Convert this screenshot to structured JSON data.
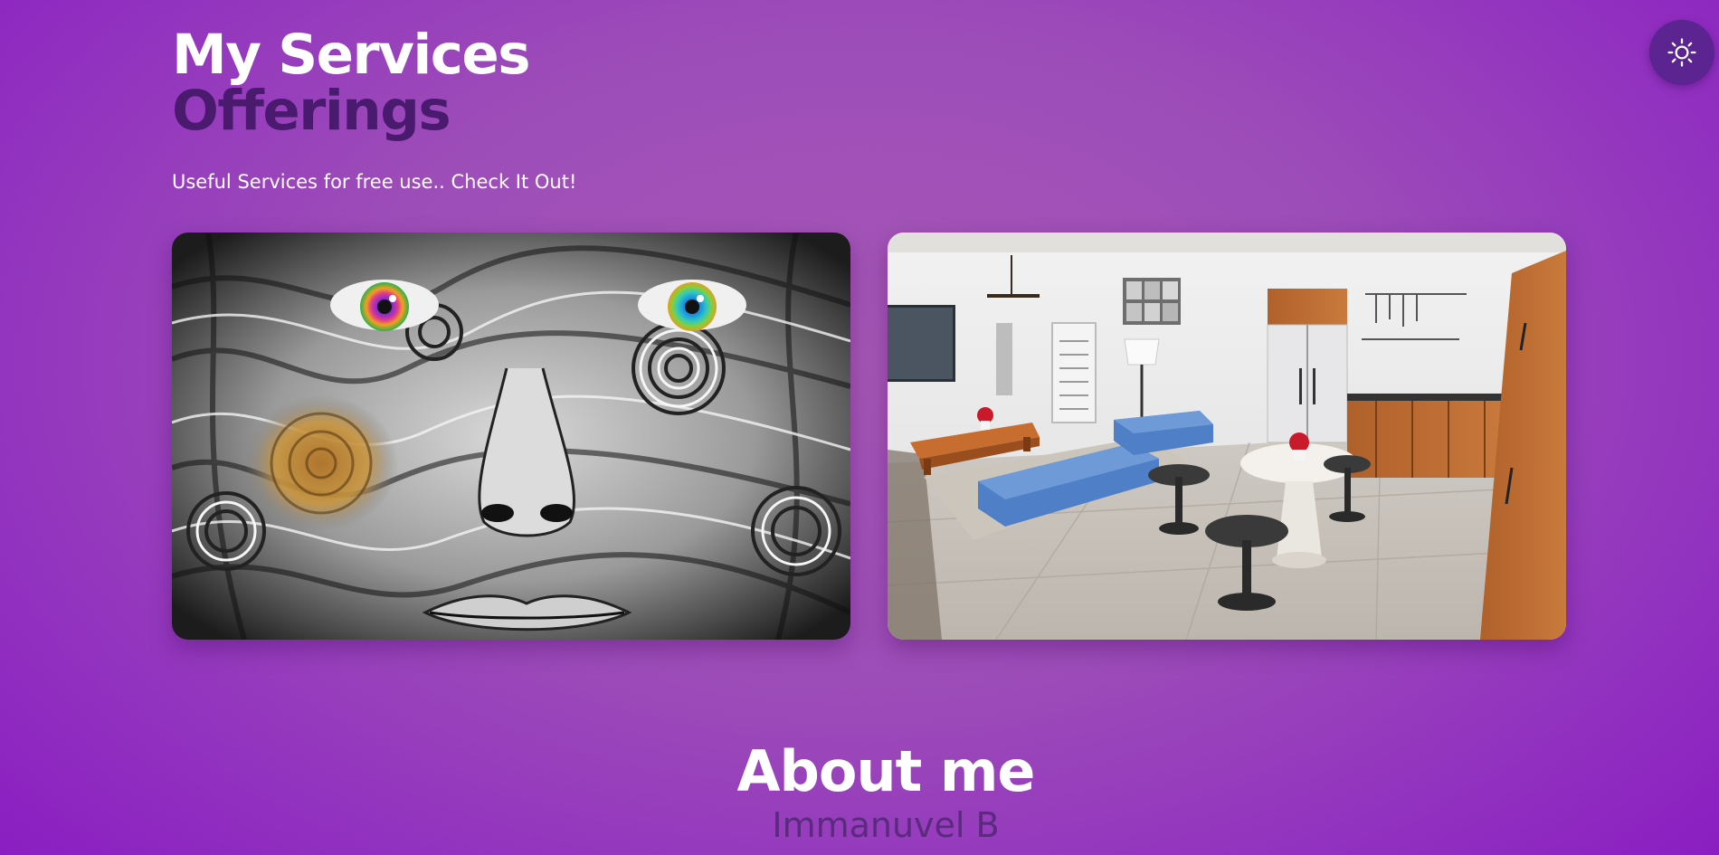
{
  "theme_toggle": {
    "icon": "sun-icon",
    "accent": "#5b2490"
  },
  "services": {
    "title": "My Services",
    "subtitle": "Offerings",
    "tagline": "Useful Services for free use.. Check It Out!",
    "cards": [
      {
        "image": "swirl-art-face-image"
      },
      {
        "image": "interior-room-render-image"
      }
    ]
  },
  "about": {
    "title": "About me",
    "name": "Immanuvel B"
  },
  "colors": {
    "background": "#9d4db8",
    "subtitle": "#4a1a6e",
    "name": "#5b2a7f"
  }
}
